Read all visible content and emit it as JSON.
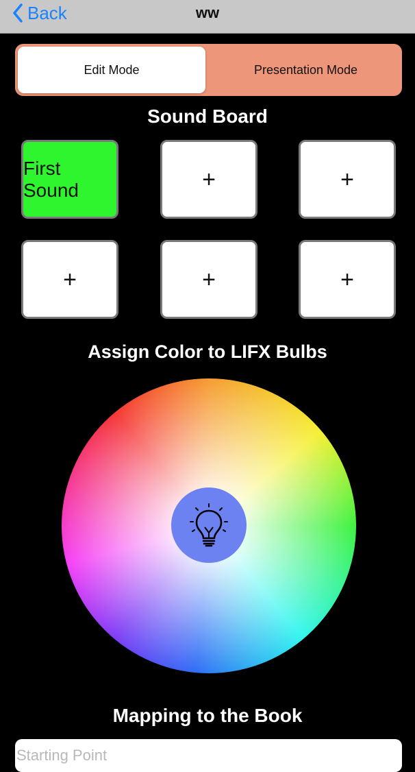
{
  "nav": {
    "back_label": "Back",
    "title": "ww"
  },
  "mode": {
    "edit_label": "Edit Mode",
    "presentation_label": "Presentation Mode",
    "selected": "Edit Mode"
  },
  "sound_board": {
    "title": "Sound Board",
    "buttons": [
      {
        "label": "First Sound",
        "active": true
      },
      {
        "label": "+"
      },
      {
        "label": "+"
      },
      {
        "label": "+"
      },
      {
        "label": "+"
      },
      {
        "label": "+"
      }
    ]
  },
  "color": {
    "title": "Assign Color to LIFX Bulbs",
    "bulb_icon": "lightbulb-icon"
  },
  "mapping": {
    "title": "Mapping to the Book",
    "starting_point_placeholder": "Starting Point",
    "starting_point_value": ""
  },
  "colors": {
    "accent": "#1a82fb",
    "segment_bg": "#ee9679",
    "active_sound": "#2ef52e",
    "bulb_button": "#6c82f0"
  }
}
